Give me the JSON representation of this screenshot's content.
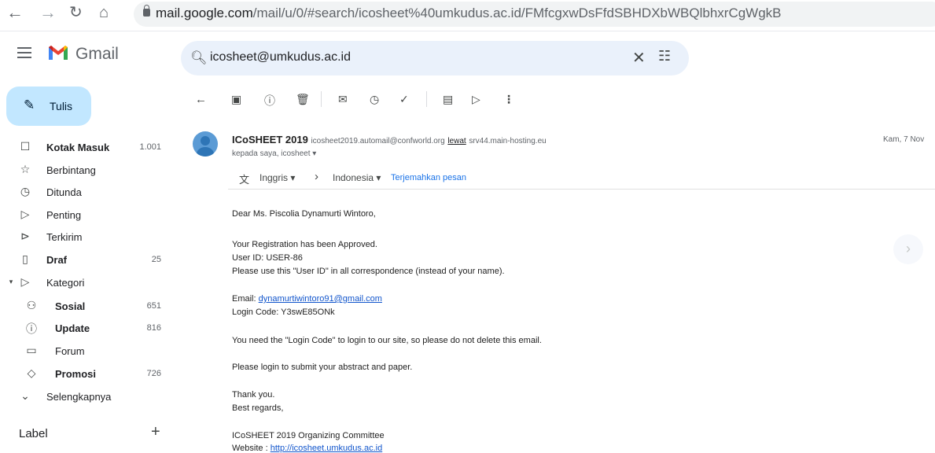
{
  "browser": {
    "url_host": "mail.google.com",
    "url_path": "/mail/u/0/#search/icosheet%40umkudus.ac.id/FMfcgxwDsFfdSBHDXbWBQlbhxrCgWgkB"
  },
  "app": {
    "name": "Gmail"
  },
  "search": {
    "query": "icosheet@umkudus.ac.id"
  },
  "compose": {
    "label": "Tulis"
  },
  "sidebar": {
    "items": [
      {
        "label": "Kotak Masuk",
        "count": "1.001",
        "bold": true,
        "icon": "inbox-icon"
      },
      {
        "label": "Berbintang",
        "count": "",
        "bold": false,
        "icon": "star-icon"
      },
      {
        "label": "Ditunda",
        "count": "",
        "bold": false,
        "icon": "clock-icon"
      },
      {
        "label": "Penting",
        "count": "",
        "bold": false,
        "icon": "important-icon"
      },
      {
        "label": "Terkirim",
        "count": "",
        "bold": false,
        "icon": "send-icon"
      },
      {
        "label": "Draf",
        "count": "25",
        "bold": true,
        "icon": "draft-icon"
      },
      {
        "label": "Kategori",
        "count": "",
        "bold": false,
        "icon": "label-icon"
      },
      {
        "label": "Sosial",
        "count": "651",
        "bold": true,
        "icon": "people-icon"
      },
      {
        "label": "Update",
        "count": "816",
        "bold": true,
        "icon": "info-icon"
      },
      {
        "label": "Forum",
        "count": "",
        "bold": false,
        "icon": "forum-icon"
      },
      {
        "label": "Promosi",
        "count": "726",
        "bold": true,
        "icon": "tag-icon"
      },
      {
        "label": "Selengkapnya",
        "count": "",
        "bold": false,
        "icon": "chevron-down-icon"
      }
    ],
    "label_heading": "Label"
  },
  "message": {
    "sender_name": "ICoSHEET 2019",
    "sender_email": "icosheet2019.automail@confworld.org",
    "via_label": "lewat",
    "via_host": "srv44.main-hosting.eu",
    "to_line": "kepada saya, icosheet",
    "date": "Kam, 7 Nov",
    "translate": {
      "from_lang": "Inggris",
      "to_lang": "Indonesia",
      "action": "Terjemahkan pesan"
    },
    "body": {
      "greeting": "Dear Ms. Piscolia Dynamurti Wintoro,",
      "approved": "Your Registration has been Approved.",
      "user_id": "User ID: USER-86",
      "use_id": "Please use this \"User ID\" in all correspondence (instead of your name).",
      "email_label": "Email: ",
      "email_value": "dynamurtiwintoro91@gmail.com",
      "login_code": "Login Code: Y3swE85ONk",
      "need_code": "You need the \"Login Code\" to login to our site, so please do not delete this email.",
      "please_login": "Please login to submit your abstract and paper.",
      "thanks": "Thank you.",
      "regards": "Best regards,",
      "committee": "ICoSHEET 2019 Organizing Committee",
      "website_label": "Website : ",
      "website_value": "http://icosheet.umkudus.ac.id"
    }
  }
}
